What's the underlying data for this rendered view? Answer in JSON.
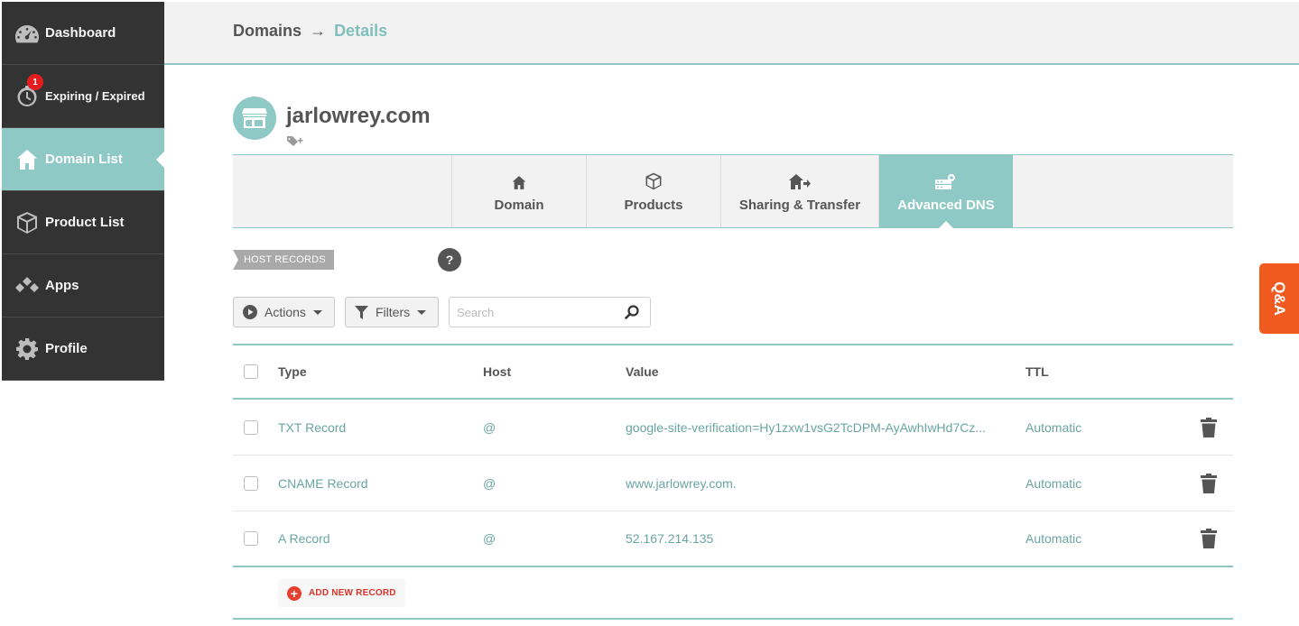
{
  "sidebar": {
    "items": [
      {
        "label": "Dashboard",
        "icon": "gauge-icon"
      },
      {
        "label": "Expiring / Expired",
        "icon": "timer-icon",
        "badge": "1"
      },
      {
        "label": "Domain List",
        "icon": "home-icon",
        "active": true
      },
      {
        "label": "Product List",
        "icon": "box-icon"
      },
      {
        "label": "Apps",
        "icon": "apps-icon"
      },
      {
        "label": "Profile",
        "icon": "gear-icon"
      }
    ]
  },
  "header": {
    "breadcrumb_root": "Domains",
    "breadcrumb_sep": "→",
    "breadcrumb_current": "Details"
  },
  "domain": {
    "name": "jarlowrey.com",
    "icon": "storefront-icon"
  },
  "tabs": [
    {
      "label": "Domain",
      "icon": "home-icon"
    },
    {
      "label": "Products",
      "icon": "box-icon"
    },
    {
      "label": "Sharing & Transfer",
      "icon": "house-arrow-icon"
    },
    {
      "label": "Advanced DNS",
      "icon": "server-gear-icon",
      "active": true
    }
  ],
  "section": {
    "label": "HOST RECORDS",
    "help": "?"
  },
  "toolbar": {
    "actions_label": "Actions",
    "filters_label": "Filters",
    "search_placeholder": "Search"
  },
  "table": {
    "headers": {
      "type": "Type",
      "host": "Host",
      "value": "Value",
      "ttl": "TTL"
    },
    "rows": [
      {
        "type": "TXT Record",
        "host": "@",
        "value": "google-site-verification=Hy1zxw1vsG2TcDPM-AyAwhIwHd7Cz...",
        "ttl": "Automatic"
      },
      {
        "type": "CNAME Record",
        "host": "@",
        "value": "www.jarlowrey.com.",
        "ttl": "Automatic"
      },
      {
        "type": "A Record",
        "host": "@",
        "value": "52.167.214.135",
        "ttl": "Automatic"
      }
    ],
    "add_label": "ADD NEW RECORD"
  },
  "qa_label": "Q&A",
  "colors": {
    "accent": "#8ec9c6",
    "sidebar": "#333333",
    "badge": "#e41e1e",
    "qa": "#f05a1f"
  }
}
